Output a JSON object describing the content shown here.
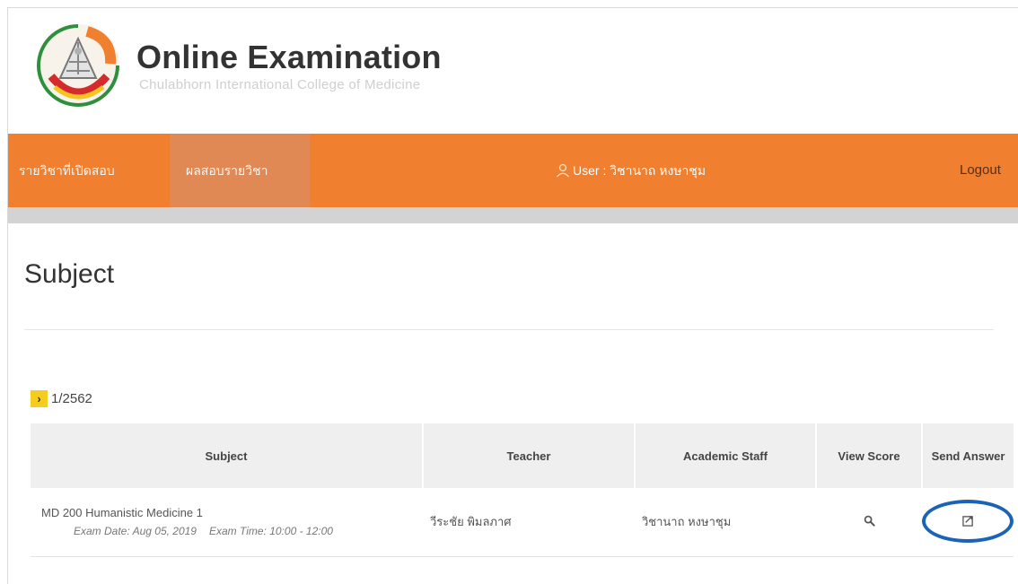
{
  "header": {
    "title": "Online Examination",
    "subtitle": "Chulabhorn International College of Medicine"
  },
  "nav": {
    "open_subjects": "รายวิชาที่เปิดสอบ",
    "results_by_subject": "ผลสอบรายวิชา",
    "user": "User : วิชานาถ หงษาชุม",
    "logout": "Logout"
  },
  "page": {
    "title": "Subject",
    "term": "1/2562"
  },
  "table": {
    "headers": {
      "subject": "Subject",
      "teacher": "Teacher",
      "academic_staff": "Academic Staff",
      "view_score": "View Score",
      "send_answer": "Send Answer"
    },
    "rows": [
      {
        "subject": "MD 200 Humanistic Medicine 1",
        "exam_date": "Exam Date: Aug 05, 2019",
        "exam_time": "Exam Time: 10:00 - 12:00",
        "teacher": "วีระชัย พิมลภาศ",
        "academic_staff": "วิชานาถ หงษาชุม"
      }
    ]
  },
  "icons": {
    "view_score": "magnifier-icon",
    "send_answer": "send-answer-icon",
    "user": "user-icon",
    "term_toggle": "chevron-right-icon"
  },
  "colors": {
    "navbar": "#f07f2f",
    "nav_active": "#df8a59",
    "term_badge": "#f4cd1f",
    "highlight_ring": "#1a63b6"
  }
}
